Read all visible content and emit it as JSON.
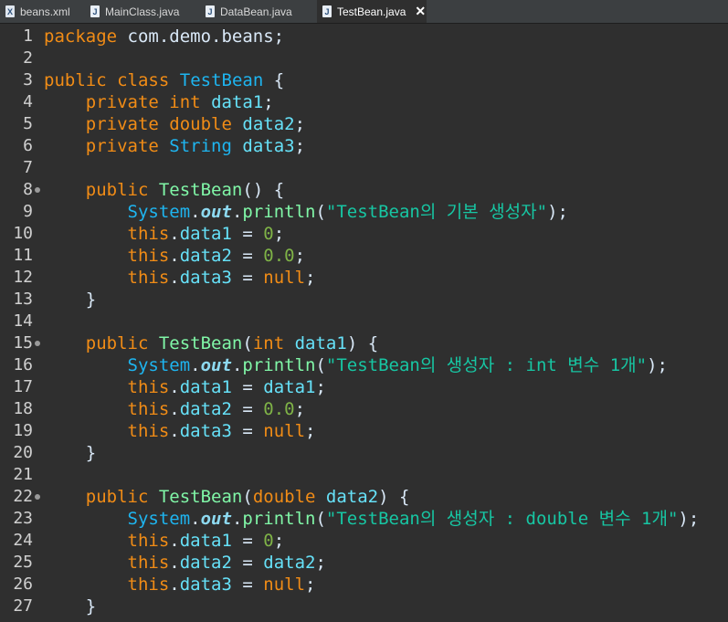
{
  "tabs": [
    {
      "label": "beans.xml",
      "icon": "xml-file-icon",
      "active": false
    },
    {
      "label": "MainClass.java",
      "icon": "java-file-icon",
      "active": false
    },
    {
      "label": "DataBean.java",
      "icon": "java-file-icon",
      "active": false
    },
    {
      "label": "TestBean.java",
      "icon": "java-file-icon",
      "active": true
    }
  ],
  "close_glyph": "✕",
  "colors": {
    "keyword": "#f18c16",
    "type": "#1eb5f0",
    "method": "#80f6a7",
    "field": "#66e1f8",
    "string": "#17c6a3",
    "number": "#7fb347",
    "background": "#2f2f2f"
  },
  "lines": [
    {
      "n": "1",
      "tokens": [
        [
          "kw",
          "package"
        ],
        [
          "pl",
          " com.demo.beans;"
        ]
      ]
    },
    {
      "n": "2",
      "tokens": []
    },
    {
      "n": "3",
      "tokens": [
        [
          "kw",
          "public"
        ],
        [
          "pl",
          " "
        ],
        [
          "kw",
          "class"
        ],
        [
          "pl",
          " "
        ],
        [
          "type",
          "TestBean"
        ],
        [
          "pl",
          " {"
        ]
      ]
    },
    {
      "n": "4",
      "tokens": [
        [
          "pl",
          "    "
        ],
        [
          "kw",
          "private"
        ],
        [
          "pl",
          " "
        ],
        [
          "kw",
          "int"
        ],
        [
          "pl",
          " "
        ],
        [
          "fld",
          "data1"
        ],
        [
          "pl",
          ";"
        ]
      ]
    },
    {
      "n": "5",
      "tokens": [
        [
          "pl",
          "    "
        ],
        [
          "kw",
          "private"
        ],
        [
          "pl",
          " "
        ],
        [
          "kw",
          "double"
        ],
        [
          "pl",
          " "
        ],
        [
          "fld",
          "data2"
        ],
        [
          "pl",
          ";"
        ]
      ]
    },
    {
      "n": "6",
      "tokens": [
        [
          "pl",
          "    "
        ],
        [
          "kw",
          "private"
        ],
        [
          "pl",
          " "
        ],
        [
          "type",
          "String"
        ],
        [
          "pl",
          " "
        ],
        [
          "fld",
          "data3"
        ],
        [
          "pl",
          ";"
        ]
      ]
    },
    {
      "n": "7",
      "tokens": []
    },
    {
      "n": "8",
      "fold": true,
      "tokens": [
        [
          "pl",
          "    "
        ],
        [
          "kw",
          "public"
        ],
        [
          "pl",
          " "
        ],
        [
          "fn",
          "TestBean"
        ],
        [
          "pl",
          "() {"
        ]
      ]
    },
    {
      "n": "9",
      "tokens": [
        [
          "pl",
          "        "
        ],
        [
          "type",
          "System"
        ],
        [
          "pl",
          "."
        ],
        [
          "out",
          "out"
        ],
        [
          "pl",
          "."
        ],
        [
          "fn",
          "println"
        ],
        [
          "pl",
          "("
        ],
        [
          "str",
          "\"TestBean의 기본 생성자\""
        ],
        [
          "pl",
          ");"
        ]
      ]
    },
    {
      "n": "10",
      "tokens": [
        [
          "pl",
          "        "
        ],
        [
          "kw",
          "this"
        ],
        [
          "pl",
          "."
        ],
        [
          "fld",
          "data1"
        ],
        [
          "pl",
          " = "
        ],
        [
          "num",
          "0"
        ],
        [
          "pl",
          ";"
        ]
      ]
    },
    {
      "n": "11",
      "tokens": [
        [
          "pl",
          "        "
        ],
        [
          "kw",
          "this"
        ],
        [
          "pl",
          "."
        ],
        [
          "fld",
          "data2"
        ],
        [
          "pl",
          " = "
        ],
        [
          "num",
          "0.0"
        ],
        [
          "pl",
          ";"
        ]
      ]
    },
    {
      "n": "12",
      "tokens": [
        [
          "pl",
          "        "
        ],
        [
          "kw",
          "this"
        ],
        [
          "pl",
          "."
        ],
        [
          "fld",
          "data3"
        ],
        [
          "pl",
          " = "
        ],
        [
          "kw",
          "null"
        ],
        [
          "pl",
          ";"
        ]
      ]
    },
    {
      "n": "13",
      "tokens": [
        [
          "pl",
          "    }"
        ]
      ]
    },
    {
      "n": "14",
      "tokens": []
    },
    {
      "n": "15",
      "fold": true,
      "tokens": [
        [
          "pl",
          "    "
        ],
        [
          "kw",
          "public"
        ],
        [
          "pl",
          " "
        ],
        [
          "fn",
          "TestBean"
        ],
        [
          "pl",
          "("
        ],
        [
          "kw",
          "int"
        ],
        [
          "pl",
          " "
        ],
        [
          "fld",
          "data1"
        ],
        [
          "pl",
          ") {"
        ]
      ]
    },
    {
      "n": "16",
      "tokens": [
        [
          "pl",
          "        "
        ],
        [
          "type",
          "System"
        ],
        [
          "pl",
          "."
        ],
        [
          "out",
          "out"
        ],
        [
          "pl",
          "."
        ],
        [
          "fn",
          "println"
        ],
        [
          "pl",
          "("
        ],
        [
          "str",
          "\"TestBean의 생성자 : int 변수 1개\""
        ],
        [
          "pl",
          ");"
        ]
      ]
    },
    {
      "n": "17",
      "tokens": [
        [
          "pl",
          "        "
        ],
        [
          "kw",
          "this"
        ],
        [
          "pl",
          "."
        ],
        [
          "fld",
          "data1"
        ],
        [
          "pl",
          " = "
        ],
        [
          "fld",
          "data1"
        ],
        [
          "pl",
          ";"
        ]
      ]
    },
    {
      "n": "18",
      "tokens": [
        [
          "pl",
          "        "
        ],
        [
          "kw",
          "this"
        ],
        [
          "pl",
          "."
        ],
        [
          "fld",
          "data2"
        ],
        [
          "pl",
          " = "
        ],
        [
          "num",
          "0.0"
        ],
        [
          "pl",
          ";"
        ]
      ]
    },
    {
      "n": "19",
      "tokens": [
        [
          "pl",
          "        "
        ],
        [
          "kw",
          "this"
        ],
        [
          "pl",
          "."
        ],
        [
          "fld",
          "data3"
        ],
        [
          "pl",
          " = "
        ],
        [
          "kw",
          "null"
        ],
        [
          "pl",
          ";"
        ]
      ]
    },
    {
      "n": "20",
      "tokens": [
        [
          "pl",
          "    }"
        ]
      ]
    },
    {
      "n": "21",
      "tokens": []
    },
    {
      "n": "22",
      "fold": true,
      "tokens": [
        [
          "pl",
          "    "
        ],
        [
          "kw",
          "public"
        ],
        [
          "pl",
          " "
        ],
        [
          "fn",
          "TestBean"
        ],
        [
          "pl",
          "("
        ],
        [
          "kw",
          "double"
        ],
        [
          "pl",
          " "
        ],
        [
          "fld",
          "data2"
        ],
        [
          "pl",
          ") {"
        ]
      ]
    },
    {
      "n": "23",
      "tokens": [
        [
          "pl",
          "        "
        ],
        [
          "type",
          "System"
        ],
        [
          "pl",
          "."
        ],
        [
          "out",
          "out"
        ],
        [
          "pl",
          "."
        ],
        [
          "fn",
          "println"
        ],
        [
          "pl",
          "("
        ],
        [
          "str",
          "\"TestBean의 생성자 : double 변수 1개\""
        ],
        [
          "pl",
          ");"
        ]
      ]
    },
    {
      "n": "24",
      "tokens": [
        [
          "pl",
          "        "
        ],
        [
          "kw",
          "this"
        ],
        [
          "pl",
          "."
        ],
        [
          "fld",
          "data1"
        ],
        [
          "pl",
          " = "
        ],
        [
          "num",
          "0"
        ],
        [
          "pl",
          ";"
        ]
      ]
    },
    {
      "n": "25",
      "tokens": [
        [
          "pl",
          "        "
        ],
        [
          "kw",
          "this"
        ],
        [
          "pl",
          "."
        ],
        [
          "fld",
          "data2"
        ],
        [
          "pl",
          " = "
        ],
        [
          "fld",
          "data2"
        ],
        [
          "pl",
          ";"
        ]
      ]
    },
    {
      "n": "26",
      "tokens": [
        [
          "pl",
          "        "
        ],
        [
          "kw",
          "this"
        ],
        [
          "pl",
          "."
        ],
        [
          "fld",
          "data3"
        ],
        [
          "pl",
          " = "
        ],
        [
          "kw",
          "null"
        ],
        [
          "pl",
          ";"
        ]
      ]
    },
    {
      "n": "27",
      "tokens": [
        [
          "pl",
          "    }"
        ]
      ]
    }
  ]
}
